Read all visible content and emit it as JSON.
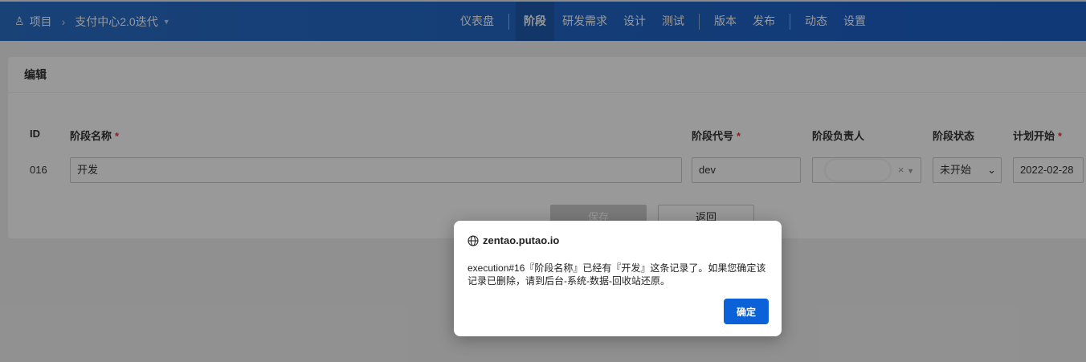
{
  "header": {
    "project_label": "项目",
    "iteration": "支付中心2.0迭代",
    "nav": [
      "仪表盘",
      "阶段",
      "研发需求",
      "设计",
      "测试",
      "版本",
      "发布",
      "动态",
      "设置"
    ],
    "active_nav": "阶段"
  },
  "form": {
    "title": "编辑",
    "columns": {
      "id": "ID",
      "name": "阶段名称",
      "code": "阶段代号",
      "owner": "阶段负责人",
      "status": "阶段状态",
      "plan_start": "计划开始"
    },
    "row": {
      "id": "016",
      "name": "开发",
      "code": "dev",
      "status": "未开始",
      "plan_start": "2022-02-28"
    },
    "save_label": "保存",
    "back_label": "返回"
  },
  "dialog": {
    "origin": "zentao.putao.io",
    "message": "execution#16『阶段名称』已经有『开发』这条记录了。如果您确定该记录已删除，请到后台-系统-数据-回收站还原。",
    "ok_label": "确定"
  }
}
